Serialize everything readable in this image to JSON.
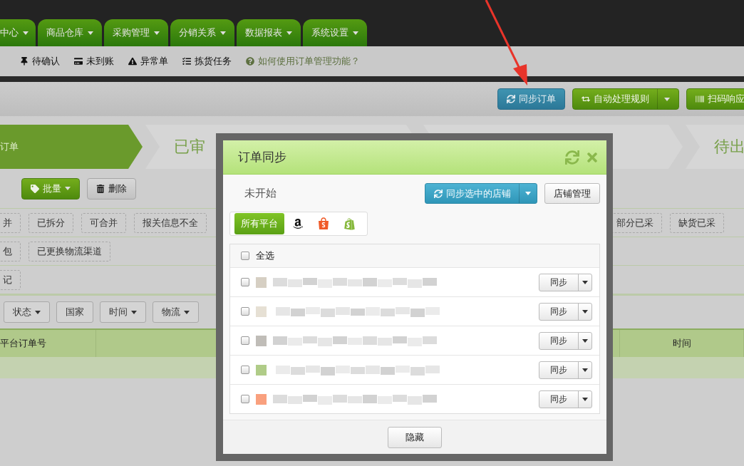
{
  "nav_tabs": [
    {
      "label": "中心"
    },
    {
      "label": "商品仓库"
    },
    {
      "label": "采购管理"
    },
    {
      "label": "分销关系"
    },
    {
      "label": "数据报表"
    },
    {
      "label": "系统设置"
    }
  ],
  "sub_nav": [
    {
      "label": "待确认",
      "kind": "pin"
    },
    {
      "label": "未到账",
      "kind": "card"
    },
    {
      "label": "异常单",
      "kind": "warning"
    },
    {
      "label": "拣货任务",
      "kind": "list"
    },
    {
      "label": "如何使用订单管理功能？",
      "kind": "help"
    }
  ],
  "toolbar": [
    {
      "label": "同步订单",
      "kind": "sync",
      "dropdown": false
    },
    {
      "label": "自动处理规则",
      "kind": "rule",
      "dropdown": true
    },
    {
      "label": "扫码响应",
      "kind": "barcode",
      "dropdown": false
    }
  ],
  "steps": [
    {
      "label": "订单",
      "selected": true
    },
    {
      "label": "已审",
      "selected": false
    },
    {
      "selected": false
    },
    {
      "label": "待出",
      "selected": false
    }
  ],
  "actions": [
    {
      "label": "批量",
      "kind": "tag",
      "dropdown": true
    },
    {
      "label": "删除",
      "kind": "trash",
      "dropdown": false
    }
  ],
  "tag_rows": [
    {
      "left": [
        "并",
        "已拆分",
        "可合并",
        "报关信息不全"
      ],
      "right": [
        "部分已采",
        "缺货已采"
      ]
    },
    {
      "left": [
        "包",
        "已更换物流渠道"
      ]
    },
    {
      "left": [
        "记"
      ]
    }
  ],
  "filters": [
    {
      "label": "状态",
      "dropdown": true
    },
    {
      "label": "国家",
      "dropdown": false
    },
    {
      "label": "时间",
      "dropdown": true
    },
    {
      "label": "物流",
      "dropdown": true
    }
  ],
  "table": {
    "columns": [
      "平台订单号",
      "时间"
    ]
  },
  "dialog": {
    "title": "订单同步",
    "status": "未开始",
    "sync_button": "同步选中的店铺",
    "manage_button": "店铺管理",
    "platforms": [
      {
        "kind": "all",
        "label": "所有平台",
        "selected": true
      },
      {
        "kind": "amazon",
        "selected": false
      },
      {
        "kind": "shopee",
        "selected": false
      },
      {
        "kind": "shopify",
        "selected": false
      }
    ],
    "select_all": {
      "label": "全选",
      "checked": false
    },
    "stores": [
      {
        "checked": false,
        "color": "#d6cfc3",
        "sync_label": "同步"
      },
      {
        "checked": false,
        "color": "#e6e0d4",
        "sync_label": "同步"
      },
      {
        "checked": false,
        "color": "#c0bdb8",
        "sync_label": "同步"
      },
      {
        "checked": false,
        "color": "#b0cc88",
        "sync_label": "同步"
      },
      {
        "checked": false,
        "color": "#f9a07e",
        "sync_label": "同步"
      }
    ],
    "hide_button": "隐藏"
  }
}
